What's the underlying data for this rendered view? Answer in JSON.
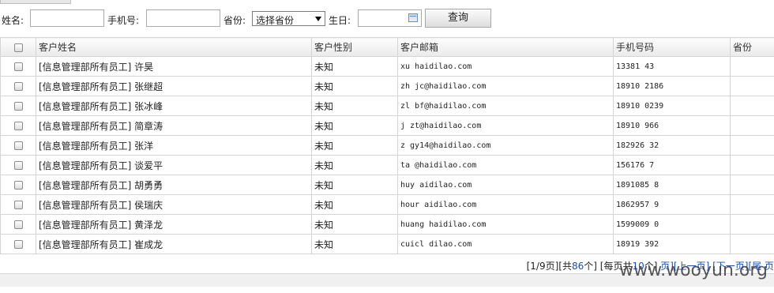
{
  "filters": {
    "name_label": "姓名:",
    "phone_label": "手机号:",
    "province_label": "省份:",
    "province_selected": "选择省份",
    "birthday_label": "生日:",
    "search_button": "查询"
  },
  "table": {
    "columns": [
      "客户姓名",
      "客户性别",
      "客户邮箱",
      "手机号码",
      "省份"
    ],
    "rows": [
      {
        "name": "[信息管理部所有员工] 许昊",
        "gender": "未知",
        "email": "xu    haidilao.com",
        "phone": "13381   43",
        "province": ""
      },
      {
        "name": "[信息管理部所有员工] 张继超",
        "gender": "未知",
        "email": "zh   jc@haidilao.com",
        "phone": "18910   2186",
        "province": ""
      },
      {
        "name": "[信息管理部所有员工] 张冰峰",
        "gender": "未知",
        "email": "zl   bf@haidilao.com",
        "phone": "18910   0239",
        "province": ""
      },
      {
        "name": "[信息管理部所有员工] 简章涛",
        "gender": "未知",
        "email": "j   zt@haidilao.com",
        "phone": "18910   966",
        "province": ""
      },
      {
        "name": "[信息管理部所有员工] 张洋",
        "gender": "未知",
        "email": "z   gy14@haidilao.com",
        "phone": "182926   32",
        "province": ""
      },
      {
        "name": "[信息管理部所有员工] 谈爱平",
        "gender": "未知",
        "email": "ta   @haidilao.com",
        "phone": "156176   7",
        "province": ""
      },
      {
        "name": "[信息管理部所有员工] 胡勇勇",
        "gender": "未知",
        "email": "huy   aidilao.com",
        "phone": "1891085   8",
        "province": ""
      },
      {
        "name": "[信息管理部所有员工] 侯瑞庆",
        "gender": "未知",
        "email": "hour   aidilao.com",
        "phone": "1862957   9",
        "province": ""
      },
      {
        "name": "[信息管理部所有员工] 黄泽龙",
        "gender": "未知",
        "email": "huang   haidilao.com",
        "phone": "1599009   0",
        "province": ""
      },
      {
        "name": "[信息管理部所有员工] 崔成龙",
        "gender": "未知",
        "email": "cuicl   dilao.com",
        "phone": "18919   392",
        "province": ""
      }
    ]
  },
  "pager": {
    "page_info": "[1/9页]",
    "total_prefix": "[共",
    "total": "86",
    "total_suffix": "个]",
    "per_page_prefix": "[每页共",
    "per_page": "10",
    "per_page_suffix": "个]",
    "prev_fragment": "页][上一页]",
    "next": "[下一页]",
    "last": "[尾 页"
  },
  "watermark": "www.wooyun.org"
}
